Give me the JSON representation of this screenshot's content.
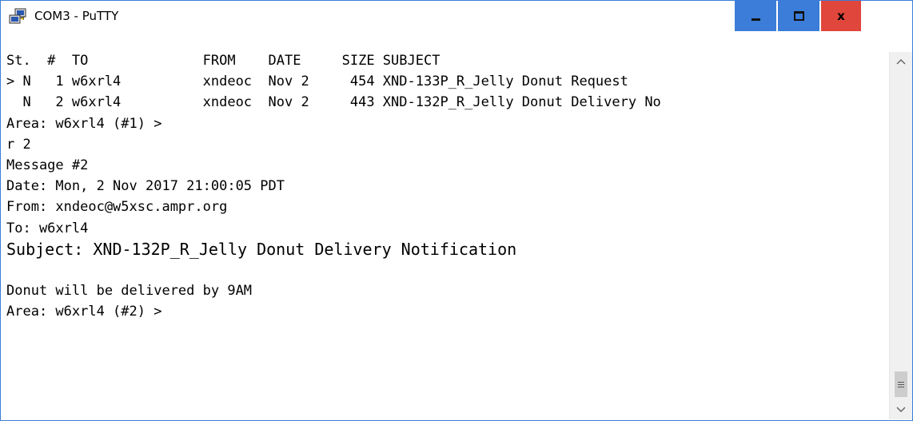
{
  "window": {
    "title": "COM3 - PuTTY",
    "controls": {
      "minimize_icon": "minimize-icon",
      "maximize_icon": "maximize-icon",
      "close_label": "x"
    },
    "colors": {
      "control_bg": "#3b7dd8",
      "close_bg": "#e0463b",
      "border": "#3b7dd8"
    }
  },
  "terminal": {
    "lines": [
      "St.  #  TO              FROM    DATE     SIZE SUBJECT",
      "> N   1 w6xrl4          xndeoc  Nov 2     454 XND-133P_R_Jelly Donut Request",
      "  N   2 w6xrl4          xndeoc  Nov 2     443 XND-132P_R_Jelly Donut Delivery No",
      "Area: w6xrl4 (#1) >",
      "r 2",
      "Message #2",
      "Date: Mon, 2 Nov 2017 21:00:05 PDT",
      "From: xndeoc@w5xsc.ampr.org",
      "To: w6xrl4",
      "Subject: XND-132P_R_Jelly Donut Delivery Notification",
      "",
      "Donut will be delivered by 9AM",
      "Area: w6xrl4 (#2) >"
    ]
  },
  "scrollbar": {
    "up_icon": "chevron-up-icon",
    "down_icon": "chevron-down-icon",
    "thumb_icon": "grip-icon"
  }
}
